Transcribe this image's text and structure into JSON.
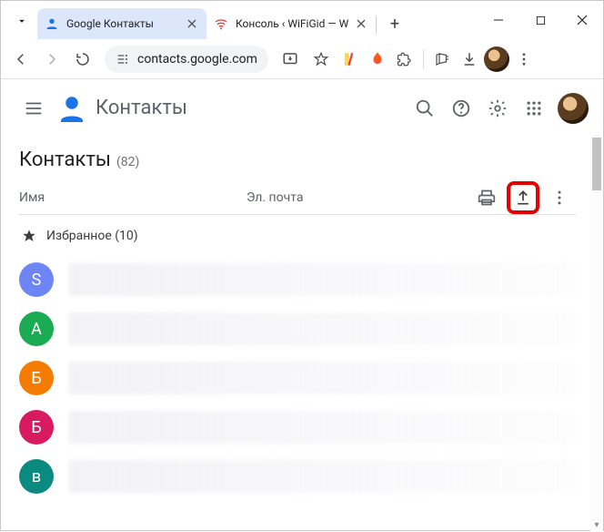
{
  "tabs": [
    {
      "title": "Google Контакты",
      "active": true,
      "favicon": "contacts"
    },
    {
      "title": "Консоль ‹ WiFiGid — W",
      "active": false,
      "favicon": "wifi"
    }
  ],
  "url": "contacts.google.com",
  "app": {
    "name": "Контакты"
  },
  "section": {
    "title": "Контакты",
    "count": "(82)"
  },
  "columns": {
    "name": "Имя",
    "email": "Эл. почта"
  },
  "favorites": {
    "label": "Избранное (10)"
  },
  "contacts": [
    {
      "letter": "S",
      "color": "#6e85f5"
    },
    {
      "letter": "А",
      "color": "#1aab53"
    },
    {
      "letter": "Б",
      "color": "#f57c00"
    },
    {
      "letter": "Б",
      "color": "#d81b60"
    },
    {
      "letter": "в",
      "color": "#0b8b7f"
    }
  ]
}
